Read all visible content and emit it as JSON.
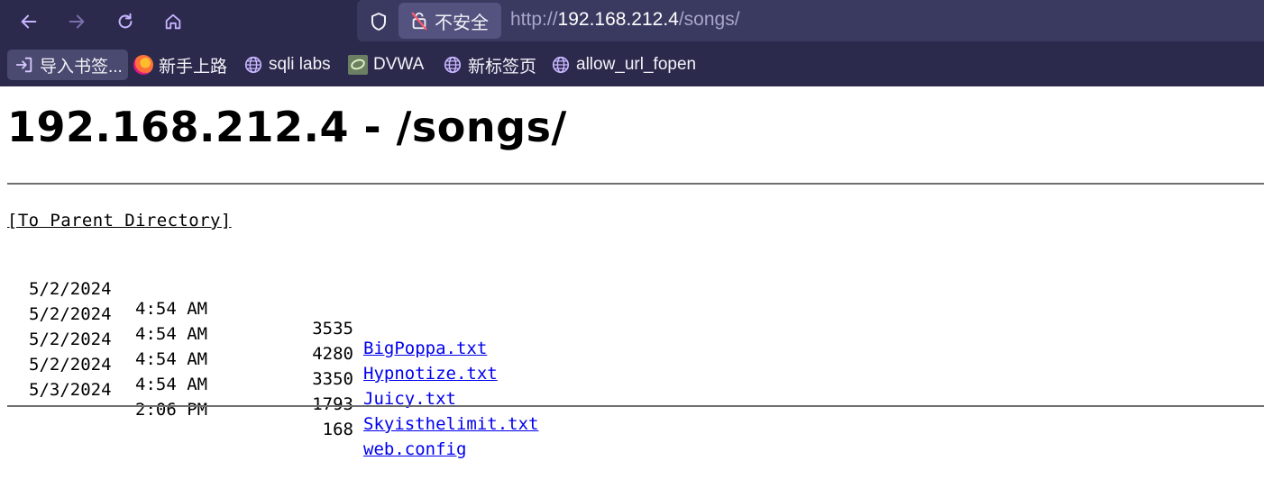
{
  "browser": {
    "security_label": "不安全",
    "url_prefix": "http://",
    "url_host": "192.168.212.4",
    "url_path": "/songs/"
  },
  "bookmarks": [
    {
      "label": "导入书签...",
      "icon": "import-icon"
    },
    {
      "label": "新手上路",
      "icon": "firefox-icon"
    },
    {
      "label": "sqli labs",
      "icon": "globe-icon"
    },
    {
      "label": "DVWA",
      "icon": "dvwa-icon"
    },
    {
      "label": "新标签页",
      "icon": "globe-icon"
    },
    {
      "label": "allow_url_fopen",
      "icon": "globe-icon"
    }
  ],
  "page": {
    "title": "192.168.212.4 - /songs/",
    "parent_link": "[To Parent Directory]",
    "files": [
      {
        "date": "5/2/2024",
        "time": "4:54 AM",
        "size": "3535",
        "name": "BigPoppa.txt"
      },
      {
        "date": "5/2/2024",
        "time": "4:54 AM",
        "size": "4280",
        "name": "Hypnotize.txt"
      },
      {
        "date": "5/2/2024",
        "time": "4:54 AM",
        "size": "3350",
        "name": "Juicy.txt"
      },
      {
        "date": "5/2/2024",
        "time": "4:54 AM",
        "size": "1793",
        "name": "Skyisthelimit.txt"
      },
      {
        "date": "5/3/2024",
        "time": "2:06 PM",
        "size": "168",
        "name": "web.config"
      }
    ]
  }
}
